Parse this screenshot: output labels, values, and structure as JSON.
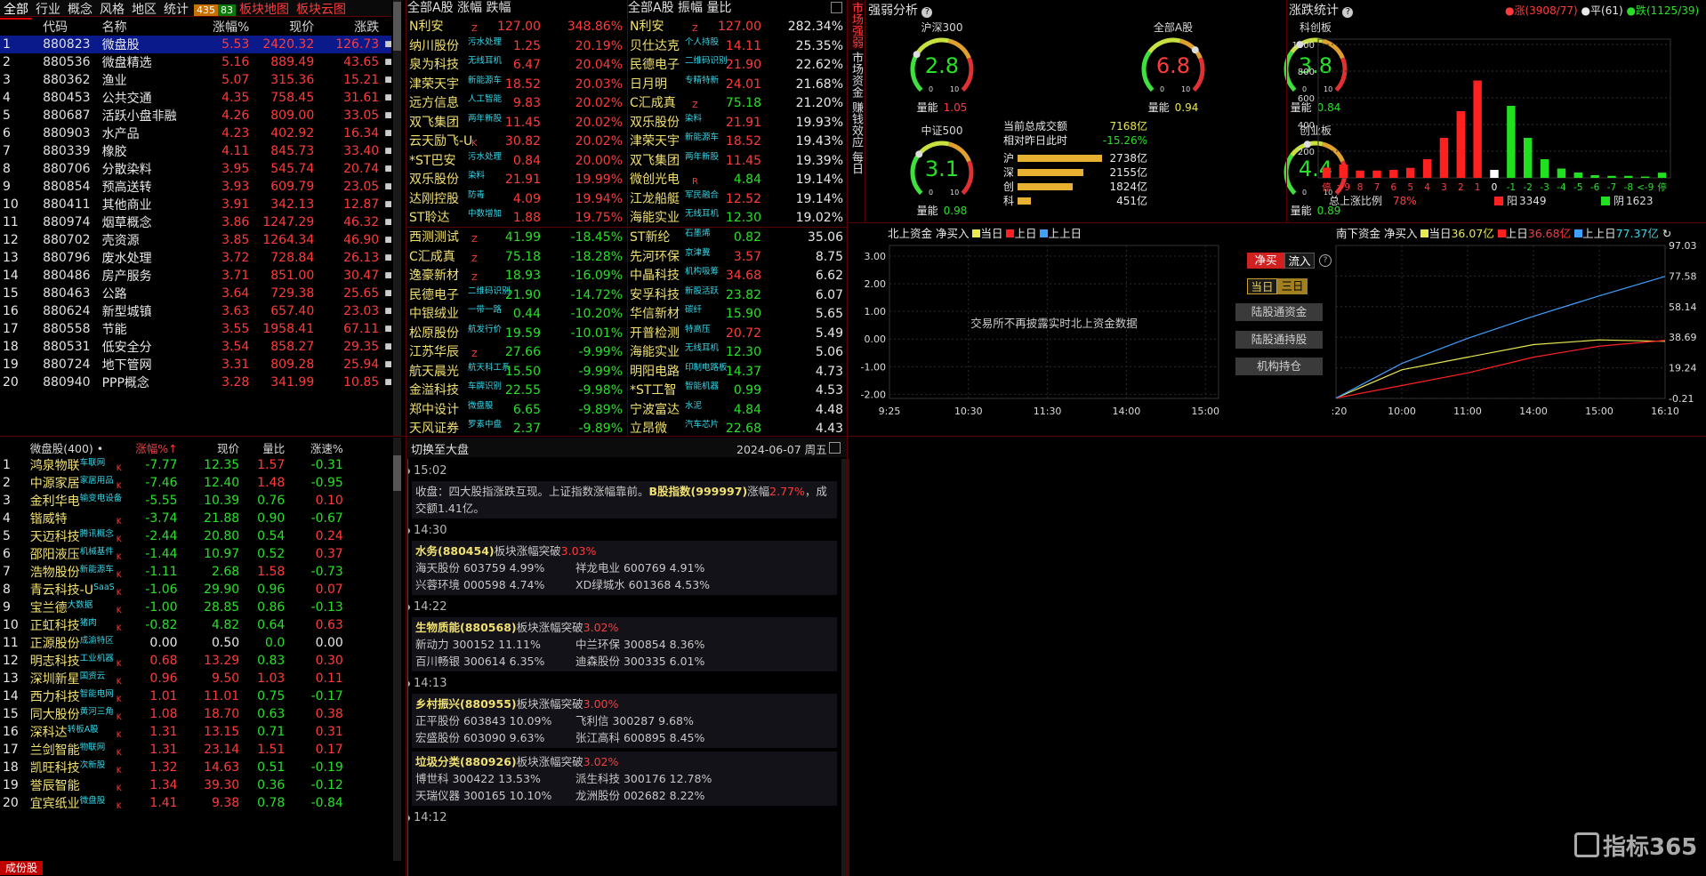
{
  "tabs": {
    "all": "全部",
    "industry": "行业",
    "concept": "概念",
    "style": "风格",
    "region": "地区",
    "stats": "统计",
    "up_count": "435",
    "dn_count": "83",
    "map": "板块地图",
    "cloud": "板块云图"
  },
  "sector_headers": [
    "代码",
    "名称",
    "涨幅%",
    "现价",
    "涨跌"
  ],
  "sectors": [
    [
      "1",
      "880823",
      "微盘股",
      "5.53",
      "2420.32",
      "126.73"
    ],
    [
      "2",
      "880536",
      "微盘精选",
      "5.16",
      "889.49",
      "43.65"
    ],
    [
      "3",
      "880362",
      "渔业",
      "5.07",
      "315.36",
      "15.21"
    ],
    [
      "4",
      "880453",
      "公共交通",
      "4.35",
      "758.45",
      "31.61"
    ],
    [
      "5",
      "880687",
      "活跃小盘非融",
      "4.26",
      "809.00",
      "33.05"
    ],
    [
      "6",
      "880903",
      "水产品",
      "4.23",
      "402.92",
      "16.34"
    ],
    [
      "7",
      "880339",
      "橡胶",
      "4.11",
      "845.73",
      "33.40"
    ],
    [
      "8",
      "880706",
      "分散染料",
      "3.95",
      "545.74",
      "20.74"
    ],
    [
      "9",
      "880854",
      "预高送转",
      "3.93",
      "609.79",
      "23.05"
    ],
    [
      "10",
      "880411",
      "其他商业",
      "3.91",
      "342.13",
      "12.87"
    ],
    [
      "11",
      "880974",
      "烟草概念",
      "3.86",
      "1247.29",
      "46.32"
    ],
    [
      "12",
      "880702",
      "壳资源",
      "3.85",
      "1264.34",
      "46.90"
    ],
    [
      "13",
      "880796",
      "废水处理",
      "3.72",
      "728.84",
      "26.13"
    ],
    [
      "14",
      "880486",
      "房产服务",
      "3.71",
      "851.00",
      "30.47"
    ],
    [
      "15",
      "880463",
      "公路",
      "3.64",
      "729.38",
      "25.65"
    ],
    [
      "16",
      "880624",
      "新型城镇",
      "3.63",
      "657.40",
      "23.03"
    ],
    [
      "17",
      "880558",
      "节能",
      "3.55",
      "1958.41",
      "67.11"
    ],
    [
      "18",
      "880531",
      "低安全分",
      "3.54",
      "858.27",
      "29.35"
    ],
    [
      "19",
      "880724",
      "地下管网",
      "3.31",
      "809.28",
      "25.94"
    ],
    [
      "20",
      "880940",
      "PPP概念",
      "3.28",
      "341.99",
      "10.85"
    ]
  ],
  "const_headers": {
    "name": "微盘股(400)",
    "dot": "•",
    "chg": "涨幅%↑",
    "price": "现价",
    "vol": "量比",
    "speed": "涨速%"
  },
  "constituents": [
    [
      "1",
      "鸿泉物联",
      "车联网",
      "K",
      "-7.77",
      "12.35",
      "1.57",
      "-0.31"
    ],
    [
      "2",
      "中源家居",
      "家居用品",
      "K",
      "-7.46",
      "12.40",
      "1.48",
      "-0.95"
    ],
    [
      "3",
      "金利华电",
      "输变电设备",
      "",
      "-5.55",
      "10.39",
      "0.76",
      "0.10"
    ],
    [
      "4",
      "锴威特",
      "",
      "K",
      "-3.74",
      "21.88",
      "0.90",
      "-0.67"
    ],
    [
      "5",
      "天迈科技",
      "腾讯概念",
      "K",
      "-2.44",
      "20.80",
      "0.54",
      "0.24"
    ],
    [
      "6",
      "邵阳液压",
      "机械基件",
      "K",
      "-1.44",
      "10.97",
      "0.52",
      "0.37"
    ],
    [
      "7",
      "浩物股份",
      "新能源车",
      "K",
      "-1.11",
      "2.68",
      "1.58",
      "-0.73"
    ],
    [
      "8",
      "青云科技-U",
      "SaaS",
      "K",
      "-1.06",
      "29.90",
      "0.96",
      "0.07"
    ],
    [
      "9",
      "宝兰德",
      "大数据",
      "K",
      "-1.00",
      "28.85",
      "0.86",
      "-0.13"
    ],
    [
      "10",
      "正虹科技",
      "猪肉",
      "K",
      "-0.82",
      "4.82",
      "0.64",
      "0.63"
    ],
    [
      "11",
      "正源股份",
      "成渝特区",
      "",
      "0.00",
      "0.50",
      "0.0",
      "0.00"
    ],
    [
      "12",
      "明志科技",
      "工业机器",
      "K",
      "0.68",
      "13.29",
      "0.83",
      "0.30"
    ],
    [
      "13",
      "深圳新星",
      "国资云",
      "K",
      "0.96",
      "9.50",
      "1.03",
      "0.11"
    ],
    [
      "14",
      "西力科技",
      "智能电网",
      "K",
      "1.01",
      "11.01",
      "0.75",
      "-0.17"
    ],
    [
      "15",
      "同大股份",
      "黄河三角",
      "K",
      "1.08",
      "18.70",
      "0.63",
      "0.38"
    ],
    [
      "16",
      "深科达",
      "转板A股",
      "K",
      "1.31",
      "13.15",
      "0.71",
      "0.31"
    ],
    [
      "17",
      "兰剑智能",
      "物联网",
      "K",
      "1.31",
      "23.14",
      "1.51",
      "0.17"
    ],
    [
      "18",
      "凯旺科技",
      "次新股",
      "K",
      "1.32",
      "14.63",
      "0.51",
      "-0.19"
    ],
    [
      "19",
      "誉辰智能",
      "",
      "K",
      "1.34",
      "39.30",
      "0.36",
      "-0.12"
    ],
    [
      "20",
      "宜宾纸业",
      "微盘股",
      "K",
      "1.41",
      "9.38",
      "0.78",
      "-0.84"
    ]
  ],
  "const_footer": "成份股",
  "rank_left_title": [
    "全部A股",
    "涨幅",
    "跌幅"
  ],
  "rank_right_title": [
    "全部A股",
    "振幅",
    "量比"
  ],
  "rank_gain": [
    [
      "N利安",
      "Z",
      "127.00",
      "348.86%",
      ""
    ],
    [
      "纳川股份",
      "污水处理",
      "1.25",
      "20.19%",
      ""
    ],
    [
      "泉为科技",
      "无线耳机",
      "6.47",
      "20.04%",
      ""
    ],
    [
      "津荣天宇",
      "新能源车",
      "18.52",
      "20.03%",
      ""
    ],
    [
      "远方信息",
      "人工智能",
      "9.83",
      "20.02%",
      ""
    ],
    [
      "双飞集团",
      "两年新股",
      "11.45",
      "20.02%",
      ""
    ],
    [
      "云天励飞-U",
      "K",
      "30.82",
      "20.02%",
      ""
    ],
    [
      "*ST巴安",
      "污水处理",
      "0.84",
      "20.00%",
      ""
    ],
    [
      "双乐股份",
      "染料",
      "21.91",
      "19.99%",
      ""
    ],
    [
      "达刚控股",
      "防毒",
      "4.09",
      "19.94%",
      ""
    ],
    [
      "ST聆达",
      "中数增加",
      "1.88",
      "19.75%",
      ""
    ]
  ],
  "rank_loss": [
    [
      "西测测试",
      "Z",
      "41.99",
      "-18.45%"
    ],
    [
      "C汇成真",
      "Z",
      "75.18",
      "-18.28%"
    ],
    [
      "逸豪新材",
      "Z",
      "18.93",
      "-16.09%"
    ],
    [
      "民德电子",
      "二维码识别",
      "21.90",
      "-14.72%"
    ],
    [
      "中银绒业",
      "一带一路",
      "0.44",
      "-10.20%"
    ],
    [
      "松原股份",
      "航发行价",
      "19.59",
      "-10.01%"
    ],
    [
      "江苏华辰",
      "Z",
      "27.66",
      "-9.99%"
    ],
    [
      "航天晨光",
      "航天科工系",
      "15.50",
      "-9.99%"
    ],
    [
      "金溢科技",
      "车牌识别",
      "22.55",
      "-9.98%"
    ],
    [
      "郑中设计",
      "微盘股",
      "6.65",
      "-9.89%"
    ],
    [
      "天风证券",
      "罗素中盘",
      "2.37",
      "-9.89%"
    ]
  ],
  "rank_amp": [
    [
      "N利安",
      "Z",
      "127.00",
      "282.34%"
    ],
    [
      "贝仕达克",
      "个人持股",
      "14.11",
      "25.35%"
    ],
    [
      "民德电子",
      "二维码识别",
      "21.90",
      "22.62%"
    ],
    [
      "日月明",
      "专精特新",
      "24.01",
      "21.68%"
    ],
    [
      "C汇成真",
      "Z",
      "75.18",
      "21.20%"
    ],
    [
      "双乐股份",
      "染料",
      "21.91",
      "19.93%"
    ],
    [
      "津荣天宇",
      "新能源车",
      "18.52",
      "19.43%"
    ],
    [
      "双飞集团",
      "两年新股",
      "11.45",
      "19.39%"
    ],
    [
      "微创光电",
      "R",
      "4.84",
      "19.14%"
    ],
    [
      "江龙船艇",
      "军民融合",
      "12.52",
      "19.14%"
    ],
    [
      "海能实业",
      "无线耳机",
      "12.30",
      "19.02%"
    ]
  ],
  "rank_vol": [
    [
      "ST新纶",
      "石墨烯",
      "0.82",
      "35.06"
    ],
    [
      "先河环保",
      "京津冀",
      "3.57",
      "8.75"
    ],
    [
      "中晶科技",
      "机构吸筹",
      "34.68",
      "6.62"
    ],
    [
      "安孚科技",
      "新股活跃",
      "23.82",
      "6.07"
    ],
    [
      "华信新材",
      "碳纤",
      "15.90",
      "5.65"
    ],
    [
      "开普检测",
      "特高压",
      "20.72",
      "5.49"
    ],
    [
      "海能实业",
      "无线耳机",
      "12.30",
      "5.06"
    ],
    [
      "明阳电路",
      "印制电路板",
      "14.37",
      "4.73"
    ],
    [
      "*ST工智",
      "智能机器",
      "0.99",
      "4.53"
    ],
    [
      "宁波富达",
      "水泥",
      "4.84",
      "4.48"
    ],
    [
      "立昂微",
      "汽车芯片",
      "22.68",
      "4.43"
    ]
  ],
  "news": {
    "switch": "切换至大盘",
    "date": "2024-06-07 周五",
    "items": [
      {
        "time": "15:02",
        "title": "",
        "text": "收盘：四大股指涨跌互现。上证指数涨幅靠前。",
        "tail_name": "B股指数(999997)",
        "tail_pre": "涨幅",
        "tail_val": "2.77%",
        "tail_end": "，成交额1.41亿。",
        "stocks": []
      },
      {
        "time": "14:30",
        "title": "水务(880454)",
        "act": "板块涨幅突破",
        "val": "3.03%",
        "stocks": [
          "海天股份 603759 4.99%",
          "祥龙电业 600769 4.91%",
          "兴蓉环境 000598 4.74%",
          "XD绿城水 601368 4.53%"
        ]
      },
      {
        "time": "14:22",
        "title": "生物质能(880568)",
        "act": "板块涨幅突破",
        "val": "3.02%",
        "stocks": [
          "新动力 300152 11.11%",
          "中兰环保 300854 8.36%",
          "百川畅银 300614 6.35%",
          "迪森股份 300335 6.01%"
        ]
      },
      {
        "time": "14:13",
        "title": "乡村振兴(880955)",
        "act": "板块涨幅突破",
        "val": "3.00%",
        "stocks": [
          "正平股份 603843 10.09%",
          "飞利信 300287 9.68%",
          "宏盛股份 603090 9.63%",
          "张江高科 600895 8.45%"
        ]
      },
      {
        "time": "",
        "title": "垃圾分类(880926)",
        "act": "板块涨幅突破",
        "val": "3.02%",
        "stocks": [
          "博世科 300422 13.53%",
          "派生科技 300176 12.78%",
          "天瑞仪器 300165 10.10%",
          "龙洲股份 002682 8.22%"
        ]
      },
      {
        "time": "14:12",
        "title": "",
        "stocks": []
      }
    ]
  },
  "side_tabs": [
    "市场强弱",
    "市场资金",
    "赚钱效应",
    "每日"
  ],
  "strength": {
    "title": "强弱分析",
    "gauges": [
      {
        "name": "沪深300",
        "value": "2.8",
        "color": "#28e028",
        "lbl": "量能",
        "v": "1.05",
        "vc": "#ff3b3b"
      },
      {
        "name": "全部A股",
        "value": "6.8",
        "color": "#ff3b3b",
        "lbl": "量能",
        "v": "0.94",
        "vc": "#e8e850"
      },
      {
        "name": "科创板",
        "value": "3.8",
        "color": "#28e028",
        "lbl": "量能",
        "v": "0.84",
        "vc": "#28e028"
      },
      {
        "name": "中证500",
        "value": "3.1",
        "color": "#28e028",
        "lbl": "量能",
        "v": "0.98",
        "vc": "#28e028"
      },
      {
        "name": "创业板",
        "value": "4.4",
        "color": "#28e028",
        "lbl": "量能",
        "v": "0.89",
        "vc": "#28e028"
      }
    ],
    "scale_min": "0",
    "scale_max": "10",
    "turnover_label": "当前总成交额",
    "turnover": "7168亿",
    "ratio_label": "相对昨日此时",
    "ratio": "-15.26%",
    "bars": [
      {
        "k": "沪",
        "v": "2738亿",
        "f": 0.95
      },
      {
        "k": "深",
        "v": "2155亿",
        "f": 0.74
      },
      {
        "k": "创",
        "v": "1824亿",
        "f": 0.62
      },
      {
        "k": "科",
        "v": "451亿",
        "f": 0.15
      }
    ]
  },
  "updown": {
    "title": "涨跌统计",
    "up_label": "涨(3908/77)",
    "flat_label": "平(61)",
    "down_label": "跌(1125/39)",
    "categories": [
      "停",
      ">9",
      "8",
      "7",
      "6",
      "5",
      "4",
      "3",
      "2",
      "1",
      "0",
      "-1",
      "-2",
      "-3",
      "-4",
      "-5",
      "-6",
      "-7",
      "-8",
      "<-9",
      "停"
    ],
    "values": [
      77,
      100,
      55,
      55,
      60,
      75,
      140,
      300,
      500,
      730,
      60,
      540,
      300,
      140,
      70,
      40,
      20,
      15,
      15,
      10,
      39
    ],
    "ymax": 1000,
    "yticks": [
      "1000",
      "800",
      "600",
      "400",
      "200"
    ],
    "footer_label": "总上涨比例",
    "footer_ratio": "78%",
    "yang_label": "阳",
    "yang": "3349",
    "yin_label": "阴",
    "yin": "1623"
  },
  "north": {
    "title": "北上资金 净买入",
    "today": "当日",
    "yday": "上日",
    "yyday": "上上日",
    "msg": "交易所不再披露实时北上资金数据",
    "yticks": [
      "3.00",
      "2.00",
      "1.00",
      "0.00",
      "-1.00",
      "-2.00"
    ],
    "xticks": [
      "9:25",
      "10:30",
      "11:30",
      "14:00",
      "15:00"
    ]
  },
  "south": {
    "title": "南下资金 净买入",
    "today": "当日",
    "today_v": "36.07亿",
    "yday": "上日",
    "yday_v": "36.68亿",
    "yyday": "上上日",
    "yyday_v": "77.37亿",
    "yticks": [
      "97.03",
      "77.58",
      "58.14",
      "38.69",
      "19.24",
      "-0.21"
    ],
    "xticks": [
      "9:20",
      "10:00",
      "11:00",
      "14:00",
      "15:00",
      "16:10"
    ],
    "chart_data": {
      "type": "line",
      "x": [
        "9:20",
        "10:00",
        "11:00",
        "14:00",
        "15:00",
        "16:10"
      ],
      "ylim": [
        -0.21,
        97.03
      ],
      "series": [
        {
          "name": "当日",
          "values": [
            0,
            18,
            26,
            34,
            37,
            36.07
          ]
        },
        {
          "name": "上日",
          "values": [
            0,
            8,
            16,
            26,
            33,
            36.68
          ]
        },
        {
          "name": "上上日",
          "values": [
            0,
            22,
            38,
            52,
            65,
            77.37
          ]
        }
      ]
    }
  },
  "south_buttons": {
    "net_buy": "净买",
    "inflow": "流入",
    "today": "当日",
    "three_day": "三日",
    "b1": "陆股通资金",
    "b2": "陆股通持股",
    "b3": "机构持仓"
  },
  "logo": "指标365"
}
